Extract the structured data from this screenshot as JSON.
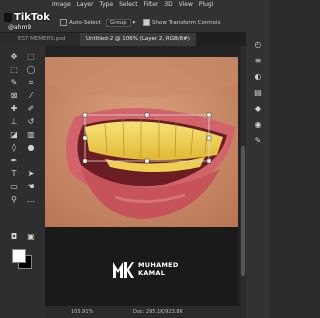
{
  "watermark": {
    "app": "TikTok",
    "handle": "@ahm9"
  },
  "menu": {
    "items": [
      "Image",
      "Layer",
      "Type",
      "Select",
      "Filter",
      "3D",
      "View",
      "Plugi"
    ]
  },
  "options": {
    "auto_select_label": "Auto-Select",
    "group_select_value": "Group",
    "show_transform_label": "Show Transform Controls"
  },
  "tabs": [
    {
      "label": "EST MEMERS.psd"
    },
    {
      "label": "Untitled-2 @ 106% (Layer 2, RGB/8#)"
    }
  ],
  "brand": {
    "line1": "MUHAMED",
    "line2": "KAMAL"
  },
  "status": {
    "zoom": "105.91%",
    "doc": "Doc: 295.1K/923.8K"
  },
  "colors": {
    "foreground": "#ffffff",
    "background": "#000000",
    "lips": "#d8616a",
    "teeth": "#f2d24a"
  }
}
